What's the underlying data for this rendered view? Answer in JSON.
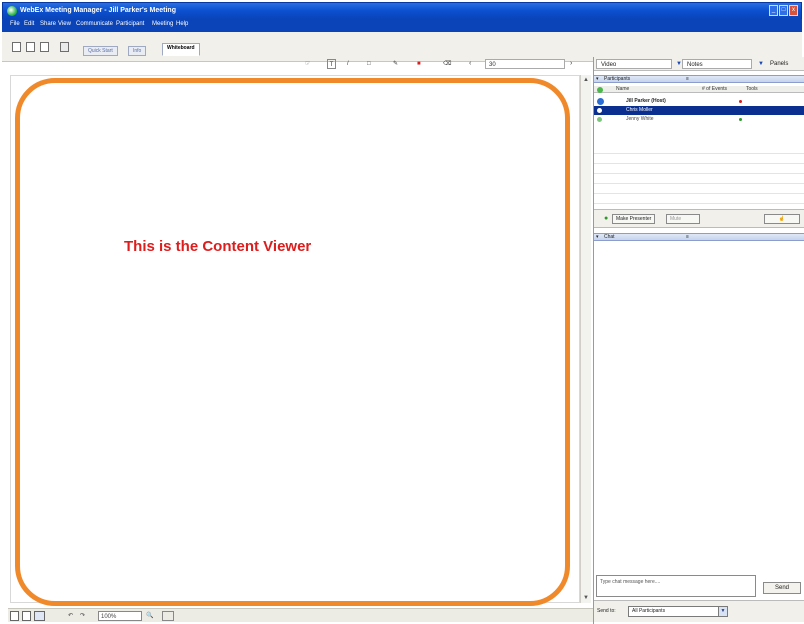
{
  "window": {
    "title": "WebEx Meeting Manager - Jill Parker's Meeting",
    "controls": [
      "_",
      "□",
      "x"
    ]
  },
  "menu": [
    "File",
    "Edit",
    "Share",
    "View",
    "Communicate",
    "Participant",
    "Meeting",
    "Help"
  ],
  "document_tabs": {
    "quick_start": "Quick Start",
    "info": "Info",
    "whiteboard": "Whiteboard"
  },
  "whiteboard_toolbar": {
    "pointer": "☞",
    "text_tool": "T",
    "line_tool": "/",
    "rect_tool": "□",
    "highlighter": "✎",
    "color": "■",
    "eraser": "⌫",
    "page_field": "30",
    "colors": {
      "color_swatch": "#d81e1e"
    }
  },
  "content_viewer": {
    "label": "This is the Content Viewer",
    "callout_color": "#f0892a",
    "label_color": "#dc1e1e"
  },
  "bottom_bar": {
    "zoom": "100%",
    "undo": "↶",
    "redo": "↷"
  },
  "panels": {
    "tabs": {
      "video": "Video",
      "notes": "Notes",
      "panels": "Panels"
    },
    "participants": {
      "header": "Participants",
      "columns": {
        "name": "Name",
        "status": "# of Events",
        "tools": "Tools"
      },
      "rows": [
        {
          "name": "Jill Parker (Host)",
          "bold": true,
          "selected": false
        },
        {
          "name": "Chris Moller",
          "bold": false,
          "selected": true
        },
        {
          "name": "Jenny White",
          "bold": false,
          "selected": false
        }
      ],
      "make_presenter": "Make Presenter",
      "mute": "Mute",
      "status_icon": "☝"
    },
    "chat": {
      "header": "Chat",
      "input_placeholder": "Type chat message here....",
      "send": "Send",
      "send_to_label": "Send to:",
      "send_to_value": "All Participants"
    }
  }
}
